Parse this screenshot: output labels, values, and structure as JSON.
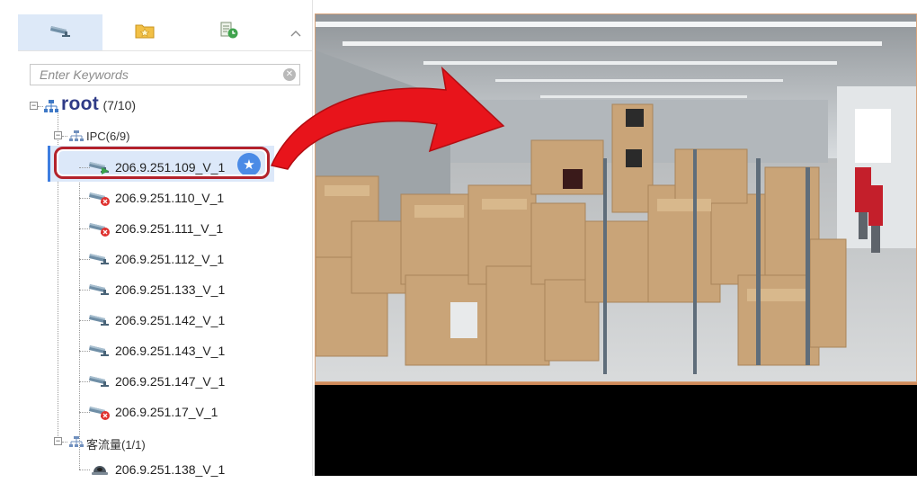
{
  "tabs": [
    {
      "id": "camera",
      "icon": "camera-icon",
      "active": true
    },
    {
      "id": "favorites",
      "icon": "favorites-folder-icon",
      "active": false
    },
    {
      "id": "record",
      "icon": "record-schedule-icon",
      "active": false
    }
  ],
  "search": {
    "placeholder": "Enter Keywords",
    "value": ""
  },
  "tree": {
    "root": {
      "label": "root",
      "count": "(7/10)"
    },
    "groups": [
      {
        "label": "IPC(6/9)",
        "cameras": [
          {
            "name": "206.9.251.109_V_1",
            "status": "online",
            "selected": true,
            "favorite": true
          },
          {
            "name": "206.9.251.110_V_1",
            "status": "offline"
          },
          {
            "name": "206.9.251.111_V_1",
            "status": "offline"
          },
          {
            "name": "206.9.251.112_V_1",
            "status": "online"
          },
          {
            "name": "206.9.251.133_V_1",
            "status": "online"
          },
          {
            "name": "206.9.251.142_V_1",
            "status": "online"
          },
          {
            "name": "206.9.251.143_V_1",
            "status": "online"
          },
          {
            "name": "206.9.251.147_V_1",
            "status": "online"
          },
          {
            "name": "206.9.251.17_V_1",
            "status": "offline"
          }
        ]
      },
      {
        "label": "客流量(1/1)",
        "cameras": [
          {
            "name": "206.9.251.138_V_1",
            "status": "online",
            "type": "dome"
          }
        ]
      }
    ]
  },
  "colors": {
    "accent": "#3d7de0",
    "selection": "#dce8f9",
    "highlight_ring": "#b3222b",
    "arrow": "#e8141b",
    "offline_badge": "#e0322f",
    "video_border": "#d08a5a"
  }
}
